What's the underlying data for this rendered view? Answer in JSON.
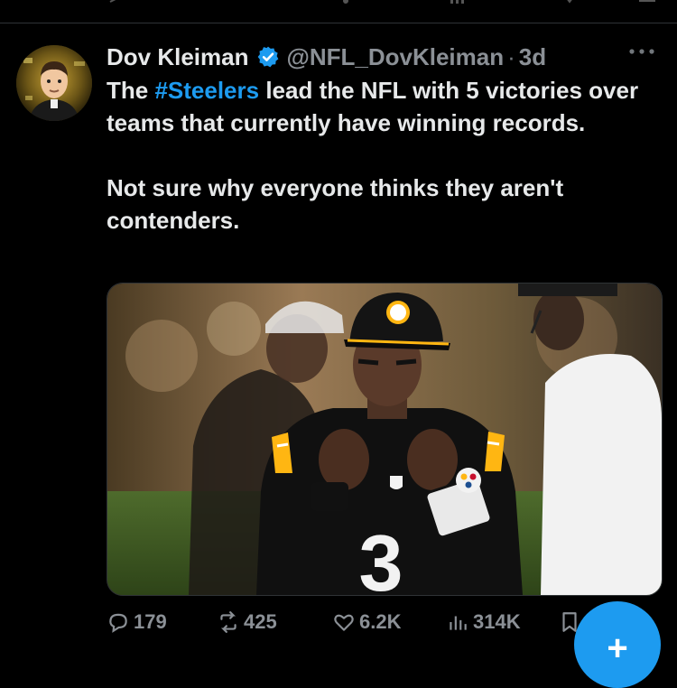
{
  "tweet": {
    "author_name": "Dov Kleiman",
    "handle": "@NFL_DovKleiman",
    "separator": "·",
    "time": "3d",
    "body_before_hashtag": "The ",
    "hashtag": "#Steelers",
    "body_after_hashtag": " lead the NFL with 5 victories over teams that currently have winning records.",
    "body_second_paragraph": "Not sure why everyone thinks they aren't contenders.",
    "media": {
      "jersey_number": "3"
    }
  },
  "actions": {
    "replies": "179",
    "reposts": "425",
    "likes": "6.2K",
    "views": "314K"
  },
  "fab": {
    "label": "+"
  },
  "colors": {
    "background": "#000000",
    "text": "#e7e9ea",
    "muted": "#71767b",
    "accent": "#1d9bf0",
    "steelers_gold": "#ffb612"
  },
  "icons": [
    "verified-badge-icon",
    "more-icon",
    "reply-icon",
    "repost-icon",
    "like-icon",
    "views-icon",
    "bookmark-icon",
    "compose-icon"
  ]
}
